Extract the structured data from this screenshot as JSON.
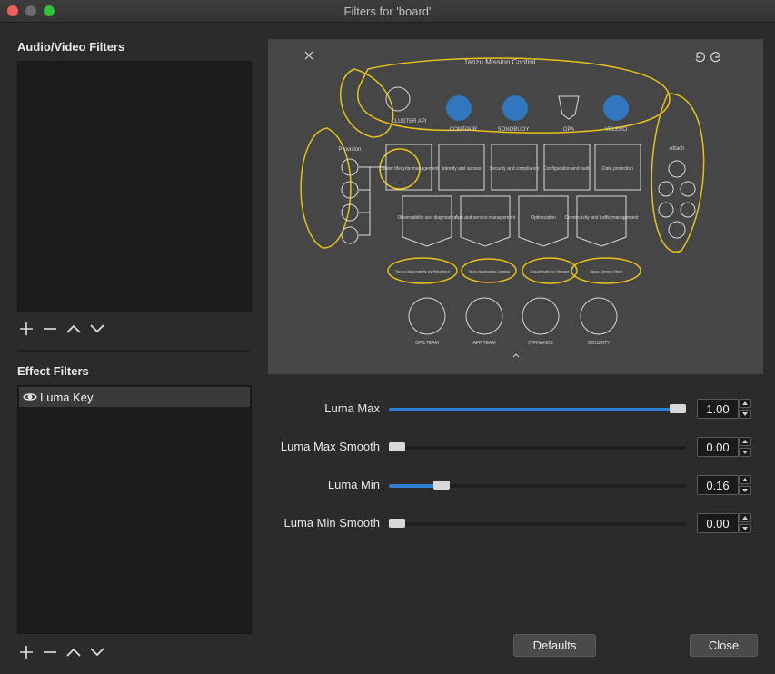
{
  "window": {
    "title": "Filters for 'board'"
  },
  "av_filters": {
    "label": "Audio/Video Filters",
    "items": []
  },
  "effect_filters": {
    "label": "Effect Filters",
    "items": [
      {
        "name": "Luma Key",
        "visible_icon": "eye-icon"
      }
    ]
  },
  "preview": {
    "header": "Tanzu Mission Control",
    "provision_label": "Provision",
    "attach_label": "Attach",
    "tools": [
      "CLUSTER API",
      "CONTOUR",
      "SONOBUOY",
      "OPA",
      "VELERO"
    ],
    "top_boxes": [
      "Cluster lifecycle management",
      "Identity and access",
      "Security and compliance",
      "Configuration and audit",
      "Data protection"
    ],
    "bottom_boxes": [
      "Observability and diagnostics",
      "App and service management",
      "Optimization",
      "Connectivity and traffic management"
    ],
    "products": [
      "Tanzu Observability by Wavefront",
      "Tanzu Application Catalog",
      "CloudHealth by VMware",
      "Tanzu Service Mesh"
    ],
    "teams": [
      "OPS TEAM",
      "APP TEAM",
      "IT FINANCE",
      "SECURITY"
    ]
  },
  "properties": [
    {
      "label": "Luma Max",
      "value": "1.00",
      "fraction": 1.0
    },
    {
      "label": "Luma Max Smooth",
      "value": "0.00",
      "fraction": 0.0
    },
    {
      "label": "Luma Min",
      "value": "0.16",
      "fraction": 0.16
    },
    {
      "label": "Luma Min Smooth",
      "value": "0.00",
      "fraction": 0.0
    }
  ],
  "buttons": {
    "defaults": "Defaults",
    "close": "Close"
  },
  "colors": {
    "accent": "#2f7fd6",
    "highlight": "#e6c21a"
  }
}
